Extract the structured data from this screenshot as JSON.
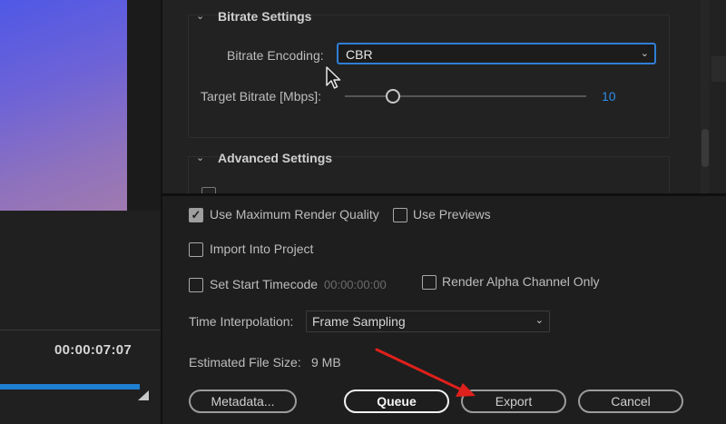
{
  "preview": {
    "timecode": "00:00:07:07"
  },
  "bitrate_settings": {
    "heading": "Bitrate Settings",
    "encoding_label": "Bitrate Encoding:",
    "encoding_value": "CBR",
    "target_label": "Target Bitrate [Mbps]:",
    "target_value": "10",
    "target_level_fraction": 0.2
  },
  "advanced_settings": {
    "heading": "Advanced Settings"
  },
  "export_options": {
    "use_max_render_quality": {
      "label": "Use Maximum Render Quality",
      "checked": true
    },
    "use_previews": {
      "label": "Use Previews",
      "checked": false
    },
    "import_into_project": {
      "label": "Import Into Project",
      "checked": false
    },
    "set_start_timecode": {
      "label": "Set Start Timecode",
      "checked": false,
      "value": "00:00:00:00"
    },
    "render_alpha_only": {
      "label": "Render Alpha Channel Only",
      "checked": false
    },
    "time_interpolation": {
      "label": "Time Interpolation:",
      "value": "Frame Sampling"
    },
    "file_size": {
      "label": "Estimated File Size:",
      "value": "9 MB"
    }
  },
  "buttons": {
    "metadata": "Metadata...",
    "queue": "Queue",
    "export": "Export",
    "cancel": "Cancel"
  },
  "colors": {
    "accent": "#2f7fd6",
    "annotation_arrow": "#e0201c"
  }
}
